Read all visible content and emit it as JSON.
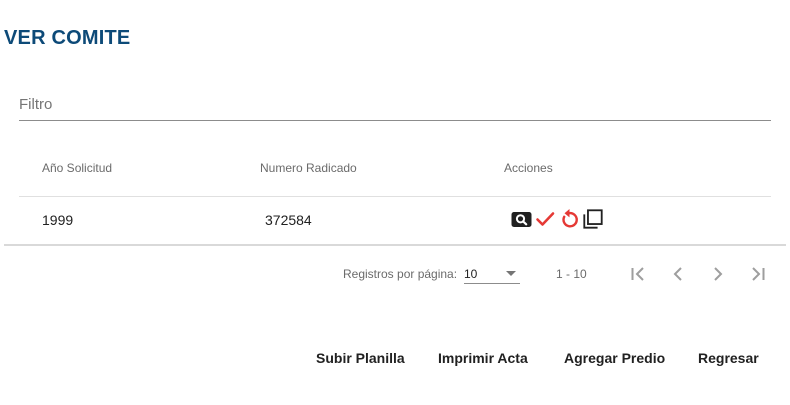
{
  "page": {
    "title": "VER COMITE"
  },
  "filter": {
    "placeholder": "Filtro",
    "value": ""
  },
  "table": {
    "columns": [
      "Año Solicitud",
      "Numero Radicado",
      "Acciones"
    ],
    "rows": [
      {
        "anio": "1999",
        "radicado": "372584",
        "actions": [
          "search-icon",
          "check-icon",
          "undo-icon",
          "copy-icon"
        ]
      }
    ]
  },
  "paginator": {
    "label": "Registros por página:",
    "page_size": "10",
    "range": "1 - 10"
  },
  "buttons": {
    "subir_planilla": "Subir Planilla",
    "imprimir_acta": "Imprimir Acta",
    "agregar_predio": "Agregar Predio",
    "regresar": "Regresar"
  },
  "colors": {
    "title": "#0d4a78",
    "accent_red": "#e53935",
    "icon_dark": "#212121"
  }
}
